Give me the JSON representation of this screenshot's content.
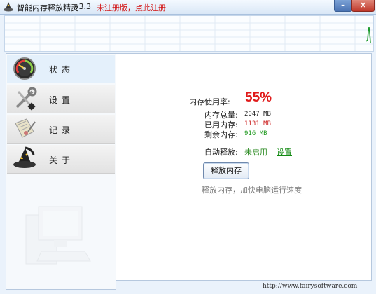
{
  "window": {
    "title": "智能内存释放精灵",
    "version": "v3.3",
    "unregistered_link": "未注册版，点此注册",
    "minimize_symbol": "–",
    "close_symbol": "×"
  },
  "sidebar": {
    "items": [
      {
        "label": "状态",
        "icon": "speedometer-icon",
        "active": true
      },
      {
        "label": "设置",
        "icon": "tools-icon",
        "active": false
      },
      {
        "label": "记录",
        "icon": "notebook-icon",
        "active": false
      },
      {
        "label": "关于",
        "icon": "wizard-hat-icon",
        "active": false
      }
    ]
  },
  "status": {
    "usage_label": "内存使用率:",
    "usage_value": "55%",
    "total_label": "内存总量:",
    "total_value": "2047 MB",
    "used_label": "已用内存:",
    "used_value": "1131 MB",
    "free_label": "剩余内存:",
    "free_value": "916 MB",
    "auto_release_label": "自动释放:",
    "auto_release_status": "未启用",
    "settings_link": "设置",
    "release_button": "释放内存",
    "hint": "释放内存，加快电脑运行速度"
  },
  "footer": {
    "url": "http://www.fairysoftware.com"
  },
  "colors": {
    "accent_red": "#e01b1b",
    "used_red": "#cc2222",
    "free_green": "#1f9a1f"
  }
}
